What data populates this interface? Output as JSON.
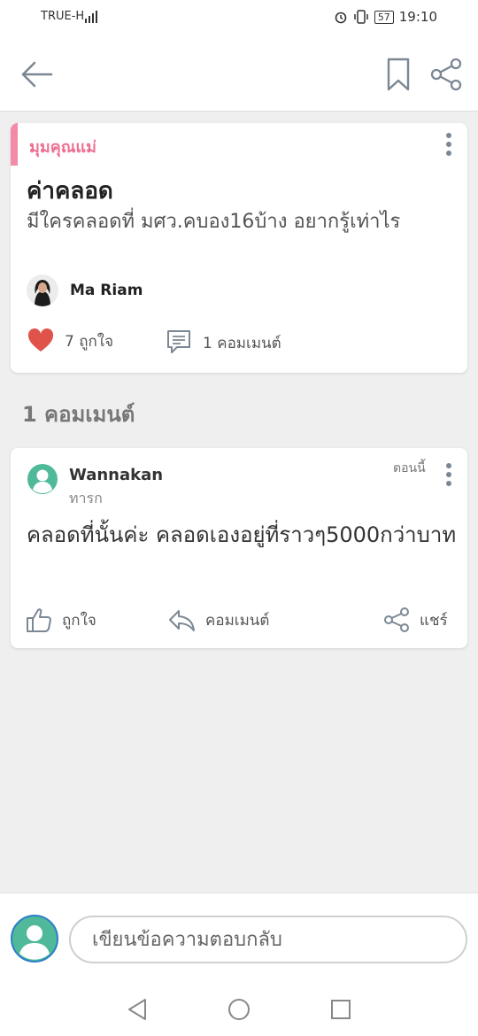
{
  "status_bar": {
    "carrier": "TRUE-H",
    "network": "4G",
    "battery": "57",
    "time": "19:10"
  },
  "post": {
    "category": "มุมคุณแม่",
    "title": "ค่าคลอด",
    "body": "มีใครคลอดที่ มศว.คบอง16บ้าง อยากรู้เท่าไร",
    "author": "Ma Riam",
    "likes": "7 ถูกใจ",
    "comments": "1 คอมเมนต์",
    "accent_color": "#ee6f90"
  },
  "comments_heading": "1 คอมเมนต์",
  "comment": {
    "name": "Wannakan",
    "subtitle": "ทารก",
    "time": "ตอนนี้",
    "text": "คลอดที่นั้นค่ะ คลอดเองอยู่ที่ราวๆ5000กว่าบาท",
    "like_label": "ถูกใจ",
    "reply_label": "คอมเมนต์",
    "share_label": "แชร์"
  },
  "reply": {
    "placeholder": "เขียนข้อความตอบกลับ"
  }
}
